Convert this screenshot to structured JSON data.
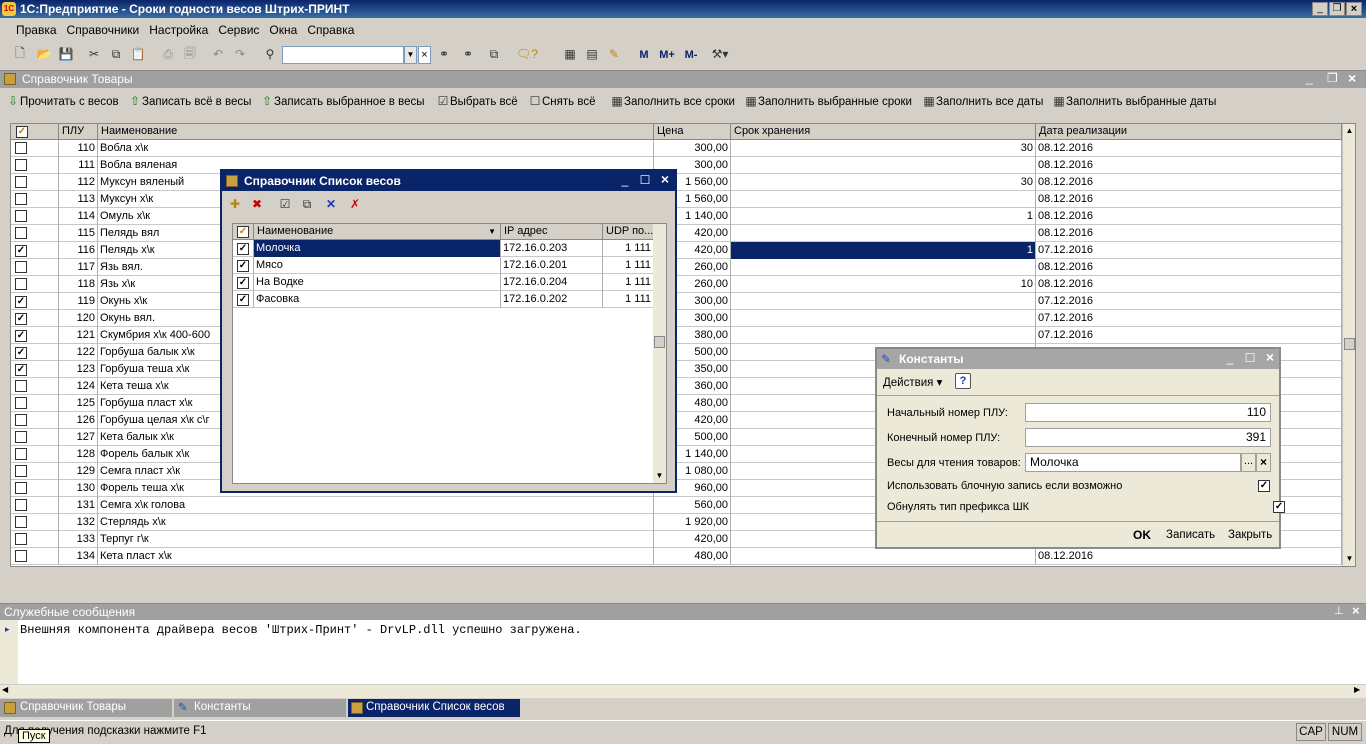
{
  "app": {
    "title": "1С:Предприятие - Сроки годности весов Штрих-ПРИНТ"
  },
  "menu": [
    "Правка",
    "Справочники",
    "Настройка",
    "Сервис",
    "Окна",
    "Справка"
  ],
  "toolbar": {
    "m1": "М",
    "m2": "М+",
    "m3": "М-"
  },
  "products": {
    "title": "Справочник Товары",
    "buttons": [
      "Прочитать с весов",
      "Записать всё в весы",
      "Записать выбранное в весы",
      "Выбрать всё",
      "Снять всё",
      "Заполнить все сроки",
      "Заполнить выбранные сроки",
      "Заполнить все даты",
      "Заполнить выбранные даты"
    ],
    "columns": [
      "ПЛУ",
      "Наименование",
      "Цена",
      "Срок хранения",
      "Дата реализации"
    ],
    "rows": [
      {
        "plu": "110",
        "name": "Вобла х\\к",
        "price": "300,00",
        "term": "30",
        "date": "08.12.2016",
        "checked": false
      },
      {
        "plu": "111",
        "name": "Вобла вяленая",
        "price": "300,00",
        "term": "",
        "date": "08.12.2016",
        "checked": false
      },
      {
        "plu": "112",
        "name": "Муксун вяленый",
        "price": "1 560,00",
        "term": "30",
        "date": "08.12.2016",
        "checked": false
      },
      {
        "plu": "113",
        "name": "Муксун х\\к",
        "price": "1 560,00",
        "term": "",
        "date": "08.12.2016",
        "checked": false
      },
      {
        "plu": "114",
        "name": "Омуль х\\к",
        "price": "1 140,00",
        "term": "1",
        "date": "08.12.2016",
        "checked": false
      },
      {
        "plu": "115",
        "name": "Пелядь вял",
        "price": "420,00",
        "term": "",
        "date": "08.12.2016",
        "checked": false
      },
      {
        "plu": "116",
        "name": "Пелядь х\\к",
        "price": "420,00",
        "term": "1",
        "date": "07.12.2016",
        "checked": true
      },
      {
        "plu": "117",
        "name": "Язь вял.",
        "price": "260,00",
        "term": "",
        "date": "08.12.2016",
        "checked": false
      },
      {
        "plu": "118",
        "name": "Язь х\\к",
        "price": "260,00",
        "term": "10",
        "date": "08.12.2016",
        "checked": false
      },
      {
        "plu": "119",
        "name": "Окунь х\\к",
        "price": "300,00",
        "term": "",
        "date": "07.12.2016",
        "checked": true
      },
      {
        "plu": "120",
        "name": "Окунь вял.",
        "price": "300,00",
        "term": "",
        "date": "07.12.2016",
        "checked": true
      },
      {
        "plu": "121",
        "name": "Скумбрия х\\к 400-600",
        "price": "380,00",
        "term": "",
        "date": "07.12.2016",
        "checked": true
      },
      {
        "plu": "122",
        "name": "Горбуша балык х\\к",
        "price": "500,00",
        "term": "",
        "date": "",
        "checked": true
      },
      {
        "plu": "123",
        "name": "Горбуша теша х\\к",
        "price": "350,00",
        "term": "",
        "date": "",
        "checked": true
      },
      {
        "plu": "124",
        "name": "Кета теша х\\к",
        "price": "360,00",
        "term": "",
        "date": "",
        "checked": false
      },
      {
        "plu": "125",
        "name": "Горбуша пласт  х\\к",
        "price": "480,00",
        "term": "",
        "date": "",
        "checked": false
      },
      {
        "plu": "126",
        "name": "Горбуша целая  х\\к с\\г",
        "price": "420,00",
        "term": "",
        "date": "",
        "checked": false
      },
      {
        "plu": "127",
        "name": "Кета балык х\\к",
        "price": "500,00",
        "term": "",
        "date": "",
        "checked": false
      },
      {
        "plu": "128",
        "name": "Форель балык х\\к",
        "price": "1 140,00",
        "term": "",
        "date": "",
        "checked": false
      },
      {
        "plu": "129",
        "name": "Семга пласт  х\\к",
        "price": "1 080,00",
        "term": "",
        "date": "",
        "checked": false
      },
      {
        "plu": "130",
        "name": "Форель теша х\\к",
        "price": "960,00",
        "term": "",
        "date": "",
        "checked": false
      },
      {
        "plu": "131",
        "name": "Семга  х\\к голова",
        "price": "560,00",
        "term": "",
        "date": "",
        "checked": false
      },
      {
        "plu": "132",
        "name": "Стерлядь х\\к",
        "price": "1 920,00",
        "term": "",
        "date": "",
        "checked": false
      },
      {
        "plu": "133",
        "name": "Терпуг г\\к",
        "price": "420,00",
        "term": "",
        "date": "",
        "checked": false
      },
      {
        "plu": "134",
        "name": "Кета пласт  х\\к",
        "price": "480,00",
        "term": "",
        "date": "08.12.2016",
        "checked": false
      }
    ]
  },
  "scales": {
    "title": "Справочник Список весов",
    "columns": [
      "Наименование",
      "IP адрес",
      "UDP по..."
    ],
    "rows": [
      {
        "name": "Молочка",
        "ip": "172.16.0.203",
        "udp": "1 111"
      },
      {
        "name": "Мясо",
        "ip": "172.16.0.201",
        "udp": "1 111"
      },
      {
        "name": "На Водке",
        "ip": "172.16.0.204",
        "udp": "1 111"
      },
      {
        "name": "Фасовка",
        "ip": "172.16.0.202",
        "udp": "1 111"
      }
    ]
  },
  "constants": {
    "title": "Константы",
    "actions": "Действия",
    "help": "?",
    "start_label": "Начальный номер ПЛУ:",
    "start_value": "110",
    "end_label": "Конечный номер ПЛУ:",
    "end_value": "391",
    "scale_label": "Весы для чтения товаров:",
    "scale_value": "Молочка",
    "ellipsis": "...",
    "clear": "×",
    "block_label": "Использовать блочную запись если возможно",
    "prefix_label": "Обнулять тип префикса ШК",
    "ok": "OK",
    "save": "Записать",
    "close": "Закрыть"
  },
  "messages": {
    "title": "Служебные сообщения",
    "text": "Внешняя компонента драйвера весов 'Штрих-Принт' - DrvLP.dll успешно загружена."
  },
  "taskbar": [
    "Справочник Товары",
    "Константы",
    "Справочник Список весов"
  ],
  "status": {
    "hint": "Для получения подсказки нажмите F1",
    "cap": "CAP",
    "num": "NUM",
    "start_tip": "Пуск"
  }
}
